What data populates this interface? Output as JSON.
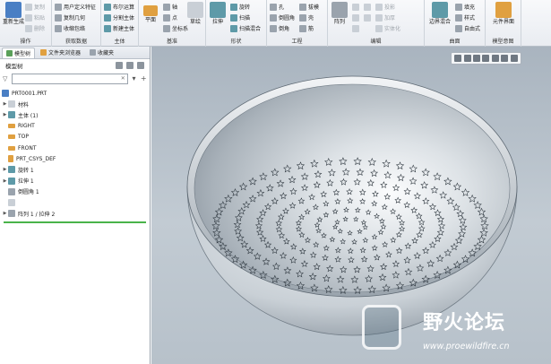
{
  "ribbon": {
    "operations": {
      "regenerate": "重新生成",
      "copy": "复制",
      "paste": "粘贴",
      "delete": "删除",
      "group_label": "操作"
    },
    "get_data": {
      "user_feature": "用户定义特征",
      "copy_geometry": "复制几何",
      "shrinkwrap": "收缩包络",
      "group_label": "获取数据"
    },
    "body": {
      "boolean": "布尔运算",
      "split_body": "分割主体",
      "new_body": "新建主体",
      "group_label": "主体"
    },
    "datum": {
      "plane": "平面",
      "axis": "轴",
      "point": "点",
      "csys": "坐标系",
      "sketch": "草绘",
      "group_label": "基准"
    },
    "shapes": {
      "extrude": "拉伸",
      "revolve": "旋转",
      "sweep": "扫描",
      "swept_blend": "扫描混合",
      "group_label": "形状"
    },
    "engineering": {
      "hole": "孔",
      "round": "倒圆角",
      "chamfer": "倒角",
      "draft": "拔模",
      "shell": "壳",
      "rib": "筋",
      "group_label": "工程"
    },
    "editing": {
      "pattern": "阵列",
      "project": "投影",
      "extend": "延伸",
      "thicken": "加厚",
      "solidify": "实体化",
      "group_label": "编辑"
    },
    "surfaces": {
      "boundary_blend": "边界混合",
      "fill": "填充",
      "style": "样式",
      "freestyle": "自由式",
      "group_label": "曲面"
    },
    "model_intent": {
      "component_interface": "元件界面",
      "group_label": "模型意图"
    }
  },
  "left_panel": {
    "tabs": [
      {
        "label": "模型树"
      },
      {
        "label": "文件夹浏览器"
      },
      {
        "label": "收藏夹"
      }
    ],
    "tree_title": "模型树",
    "search_placeholder": "",
    "items": [
      {
        "label": "PRT0001.PRT"
      },
      {
        "label": "材料"
      },
      {
        "label": "主体 (1)"
      },
      {
        "label": "RIGHT"
      },
      {
        "label": "TOP"
      },
      {
        "label": "FRONT"
      },
      {
        "label": "PRT_CSYS_DEF"
      },
      {
        "label": "旋转 1"
      },
      {
        "label": "拉伸 1"
      },
      {
        "label": "倒圆角 1"
      },
      {
        "label": "阵列 1 / 拉伸 2"
      }
    ]
  },
  "watermark": {
    "title": "野火论坛",
    "url": "www.proewildfire.cn"
  },
  "colors": {
    "background_top": "#a9b4bf",
    "background_bottom": "#c2cbd3",
    "part": "#d7dde2",
    "accent_green": "#49b34a"
  }
}
